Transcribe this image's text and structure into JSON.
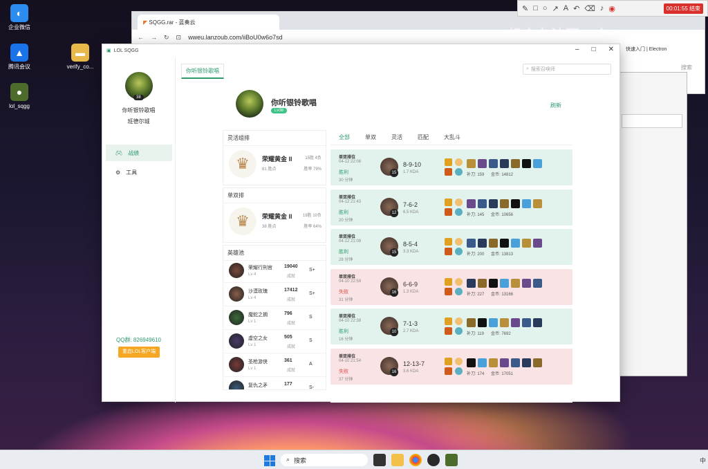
{
  "desktop": {
    "icons": [
      {
        "label": "企业微信",
        "color": "#2d8cf0"
      },
      {
        "label": "腾讯会议",
        "color": "#1a73e8"
      },
      {
        "label": "lol_sqgg",
        "color": "#4d6b2a"
      },
      {
        "label": "verify_co...",
        "color": "#e8b84a"
      }
    ]
  },
  "recorder": {
    "time": "00:01:55 结束"
  },
  "watermark": "想个办法写一个LOL...",
  "browser": {
    "tab_title": "SQGG.rar - 蓝奏云",
    "url": "wweu.lanzoub.com/iiBoU0w6o7sd",
    "bookmark": "快速入门 | Electron",
    "search_btn": "搜索"
  },
  "app": {
    "title": "LOL SQGG",
    "sidebar": {
      "name": "你听银铃歌唱",
      "server": "班德尔城",
      "level": "38",
      "nav": [
        {
          "label": "战绩",
          "active": true,
          "icon": "gamepad-icon"
        },
        {
          "label": "工具",
          "active": false,
          "icon": "gear-icon"
        }
      ],
      "qq": "QQ群: 826949610",
      "restart_btn": "重启LOL客户端"
    },
    "header": {
      "tab": "你听银铃歌唱",
      "search_placeholder": "搜索召唤师",
      "refresh": "刷新",
      "name": "你听银铃歌唱",
      "level": "Lv38"
    },
    "flex_rank": {
      "title": "灵活组排",
      "tier": "荣耀黄金 II",
      "wl": "15胜 4负",
      "points": "81 胜点",
      "winrate": "胜率 79%"
    },
    "solo_rank": {
      "title": "单双排",
      "tier": "荣耀黄金 II",
      "wl": "18胜 10负",
      "points": "38 胜点",
      "winrate": "胜率 64%"
    },
    "heroes": {
      "title": "英雄池",
      "list": [
        {
          "name": "荣耀行刑官",
          "lv": "Lv 4",
          "score": "19040",
          "unit": "成就",
          "grade": "S+"
        },
        {
          "name": "沙漠玫瑰",
          "lv": "Lv 4",
          "score": "17412",
          "unit": "成就",
          "grade": "S+"
        },
        {
          "name": "魔蛇之拥",
          "lv": "Lv 1",
          "score": "796",
          "unit": "成就",
          "grade": "S"
        },
        {
          "name": "虚空之女",
          "lv": "Lv 1",
          "score": "505",
          "unit": "成就",
          "grade": "S"
        },
        {
          "name": "圣枪游侠",
          "lv": "Lv 1",
          "score": "361",
          "unit": "成就",
          "grade": "A"
        },
        {
          "name": "复仇之矛",
          "lv": "Lv 1",
          "score": "177",
          "unit": "成就",
          "grade": "S-"
        }
      ]
    },
    "filters": [
      "全部",
      "单双",
      "灵活",
      "匹配",
      "大乱斗"
    ],
    "matches": [
      {
        "mode": "单双排位",
        "date": "04-12 22:08",
        "result": "胜利",
        "win": true,
        "dur": "30 分钟",
        "lvl": "15",
        "kda": "8-9-10",
        "kda_r": "1.7 KDA",
        "cs": "补刀: 159",
        "gold": "金币: 14812"
      },
      {
        "mode": "单双排位",
        "date": "04-12 21:43",
        "result": "胜利",
        "win": true,
        "dur": "20 分钟",
        "lvl": "12",
        "kda": "7-6-2",
        "kda_r": "6.5 KDA",
        "cs": "补刀: 145",
        "gold": "金币: 10656"
      },
      {
        "mode": "单双排位",
        "date": "04-12 21:08",
        "result": "胜利",
        "win": true,
        "dur": "28 分钟",
        "lvl": "15",
        "kda": "8-5-4",
        "kda_r": "3.3 KDA",
        "cs": "补刀: 200",
        "gold": "金币: 13813"
      },
      {
        "mode": "单双排位",
        "date": "04-10 22:58",
        "result": "失败",
        "win": false,
        "dur": "31 分钟",
        "lvl": "16",
        "kda": "6-6-9",
        "kda_r": "1.3 KDA",
        "cs": "补刀: 227",
        "gold": "金币: 13166"
      },
      {
        "mode": "单双排位",
        "date": "04-10 22:38",
        "result": "胜利",
        "win": true,
        "dur": "16 分钟",
        "lvl": "10",
        "kda": "7-1-3",
        "kda_r": "2.7 KDA",
        "cs": "补刀: 119",
        "gold": "金币: 7692"
      },
      {
        "mode": "单双排位",
        "date": "04-10 21:54",
        "result": "失败",
        "win": false,
        "dur": "37 分钟",
        "lvl": "16",
        "kda": "12-13-7",
        "kda_r": "3.6 KDA",
        "cs": "补刀: 174",
        "gold": "金币: 17051"
      }
    ]
  },
  "taskbar": {
    "search": "搜索",
    "ime": "中"
  },
  "colors": {
    "accent": "#2f9a6c",
    "win_bg": "#e2f2ec",
    "lose_bg": "#fae3e5",
    "button": "#f5a623"
  }
}
